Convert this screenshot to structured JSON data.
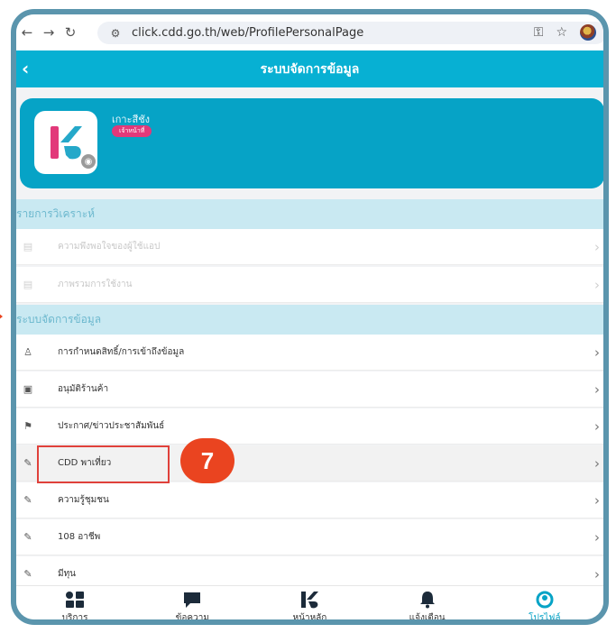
{
  "browser": {
    "url": "click.cdd.go.th/web/ProfilePersonalPage"
  },
  "header": {
    "title": "ระบบจัดการข้อมูล"
  },
  "profile": {
    "name": "เกาะสีชัง",
    "role": "เจ้าหน้าที่"
  },
  "sections": [
    {
      "title": "รายการวิเคราะห์",
      "items": [
        {
          "label": "ความพึงพอใจของผู้ใช้แอป",
          "icon": "chart-icon"
        },
        {
          "label": "ภาพรวมการใช้งาน",
          "icon": "chart-icon"
        }
      ]
    },
    {
      "title": "ระบบจัดการข้อมูล",
      "items": [
        {
          "label": "การกำหนดสิทธิ์/การเข้าถึงข้อมูล",
          "icon": "user-icon"
        },
        {
          "label": "อนุมัติร้านค้า",
          "icon": "shop-icon"
        },
        {
          "label": "ประกาศ/ข่าวประชาสัมพันธ์",
          "icon": "flag-icon"
        },
        {
          "label": "CDD พาเที่ยว",
          "icon": "pencil-icon"
        },
        {
          "label": "ความรู้ชุมชน",
          "icon": "pencil-icon"
        },
        {
          "label": "108 อาชีพ",
          "icon": "pencil-icon"
        },
        {
          "label": "มีทุน",
          "icon": "pencil-icon"
        }
      ]
    }
  ],
  "annotation": {
    "step": "7"
  },
  "tabs": [
    {
      "label": "บริการ",
      "icon": "grid-icon"
    },
    {
      "label": "ข้อความ",
      "icon": "chat-icon"
    },
    {
      "label": "หน้าหลัก",
      "icon": "home-logo-icon"
    },
    {
      "label": "แจ้งเตือน",
      "icon": "bell-icon"
    },
    {
      "label": "โปรไฟล์",
      "icon": "profile-icon"
    }
  ],
  "colors": {
    "primary": "#07b0d3",
    "accent": "#e2397a",
    "highlight": "#ea4420"
  }
}
